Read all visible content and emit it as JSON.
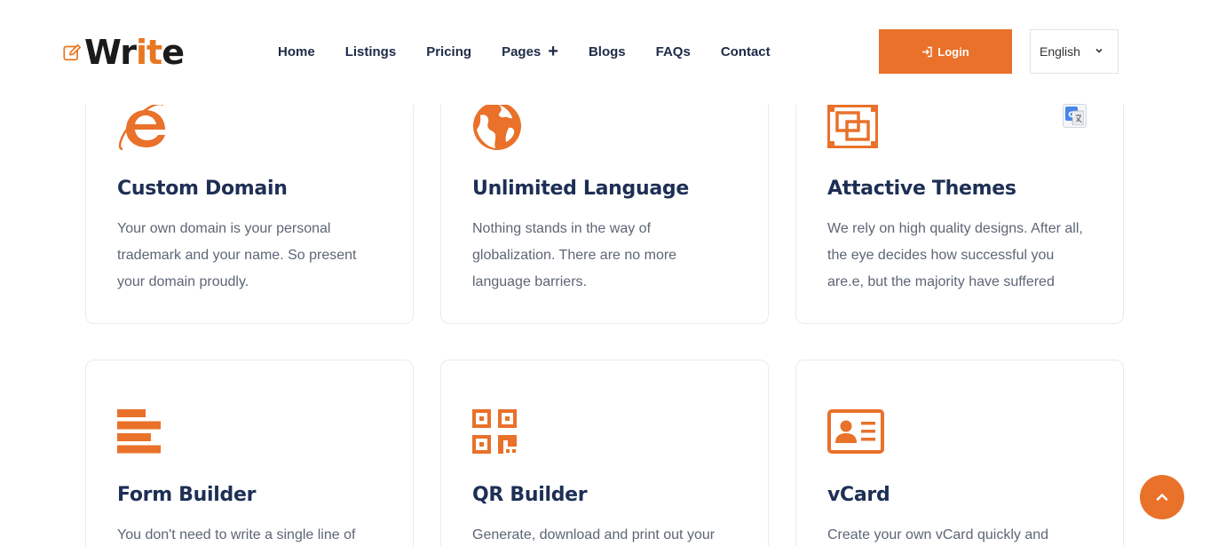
{
  "brand": {
    "logo_text_start": "Wr",
    "logo_text_accent": "it",
    "logo_text_end": "e",
    "accent_color": "#e9712a"
  },
  "nav": {
    "items": [
      {
        "label": "Home"
      },
      {
        "label": "Listings"
      },
      {
        "label": "Pricing"
      },
      {
        "label": "Pages",
        "has_submenu": true
      },
      {
        "label": "Blogs"
      },
      {
        "label": "FAQs"
      },
      {
        "label": "Contact"
      }
    ]
  },
  "header": {
    "login_label": "Login",
    "language_selected": "English"
  },
  "features": [
    {
      "icon": "internet-explorer-icon",
      "title": "Custom Domain",
      "desc": [
        "Your own domain is your personal",
        "trademark and your name. So present",
        "your domain proudly."
      ]
    },
    {
      "icon": "globe-icon",
      "title": "Unlimited Language",
      "desc": [
        "Nothing stands in the way of",
        "globalization. There are no more",
        "language barriers."
      ]
    },
    {
      "icon": "themes-icon",
      "title": "Attactive Themes",
      "desc": [
        "We rely on high quality designs. After all,",
        "the eye decides how successful you",
        "are.e, but the majority have suffered"
      ]
    },
    {
      "icon": "form-builder-icon",
      "title": "Form Builder",
      "desc": [
        "You don't need to write a single line of"
      ]
    },
    {
      "icon": "qr-code-icon",
      "title": "QR Builder",
      "desc": [
        "Generate, download and print out your"
      ]
    },
    {
      "icon": "vcard-icon",
      "title": "vCard",
      "desc": [
        "Create your own vCard quickly and"
      ]
    }
  ]
}
